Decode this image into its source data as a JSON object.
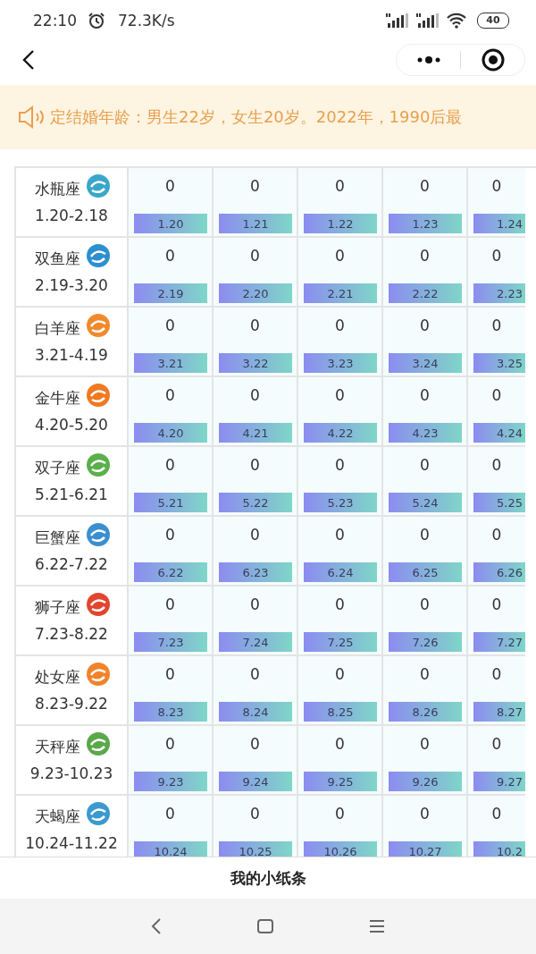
{
  "status_bar": {
    "time": "22:10",
    "speed": "72.3K/s",
    "battery": "40"
  },
  "notice": {
    "text": "定结婚年龄：男生22岁，女生20岁。2022年，1990后最"
  },
  "signs": [
    {
      "name": "水瓶座",
      "range": "1.20-2.18",
      "days": [
        {
          "count": "0",
          "date": "1.20"
        },
        {
          "count": "0",
          "date": "1.21"
        },
        {
          "count": "0",
          "date": "1.22"
        },
        {
          "count": "0",
          "date": "1.23"
        },
        {
          "count": "0",
          "date": "1.24"
        }
      ]
    },
    {
      "name": "双鱼座",
      "range": "2.19-3.20",
      "days": [
        {
          "count": "0",
          "date": "2.19"
        },
        {
          "count": "0",
          "date": "2.20"
        },
        {
          "count": "0",
          "date": "2.21"
        },
        {
          "count": "0",
          "date": "2.22"
        },
        {
          "count": "0",
          "date": "2.23"
        }
      ]
    },
    {
      "name": "白羊座",
      "range": "3.21-4.19",
      "days": [
        {
          "count": "0",
          "date": "3.21"
        },
        {
          "count": "0",
          "date": "3.22"
        },
        {
          "count": "0",
          "date": "3.23"
        },
        {
          "count": "0",
          "date": "3.24"
        },
        {
          "count": "0",
          "date": "3.25"
        }
      ]
    },
    {
      "name": "金牛座",
      "range": "4.20-5.20",
      "days": [
        {
          "count": "0",
          "date": "4.20"
        },
        {
          "count": "0",
          "date": "4.21"
        },
        {
          "count": "0",
          "date": "4.22"
        },
        {
          "count": "0",
          "date": "4.23"
        },
        {
          "count": "0",
          "date": "4.24"
        }
      ]
    },
    {
      "name": "双子座",
      "range": "5.21-6.21",
      "days": [
        {
          "count": "0",
          "date": "5.21"
        },
        {
          "count": "0",
          "date": "5.22"
        },
        {
          "count": "0",
          "date": "5.23"
        },
        {
          "count": "0",
          "date": "5.24"
        },
        {
          "count": "0",
          "date": "5.25"
        }
      ]
    },
    {
      "name": "巨蟹座",
      "range": "6.22-7.22",
      "days": [
        {
          "count": "0",
          "date": "6.22"
        },
        {
          "count": "0",
          "date": "6.23"
        },
        {
          "count": "0",
          "date": "6.24"
        },
        {
          "count": "0",
          "date": "6.25"
        },
        {
          "count": "0",
          "date": "6.26"
        }
      ]
    },
    {
      "name": "狮子座",
      "range": "7.23-8.22",
      "days": [
        {
          "count": "0",
          "date": "7.23"
        },
        {
          "count": "0",
          "date": "7.24"
        },
        {
          "count": "0",
          "date": "7.25"
        },
        {
          "count": "0",
          "date": "7.26"
        },
        {
          "count": "0",
          "date": "7.27"
        }
      ]
    },
    {
      "name": "处女座",
      "range": "8.23-9.22",
      "days": [
        {
          "count": "0",
          "date": "8.23"
        },
        {
          "count": "0",
          "date": "8.24"
        },
        {
          "count": "0",
          "date": "8.25"
        },
        {
          "count": "0",
          "date": "8.26"
        },
        {
          "count": "0",
          "date": "8.27"
        }
      ]
    },
    {
      "name": "天秤座",
      "range": "9.23-10.23",
      "days": [
        {
          "count": "0",
          "date": "9.23"
        },
        {
          "count": "0",
          "date": "9.24"
        },
        {
          "count": "0",
          "date": "9.25"
        },
        {
          "count": "0",
          "date": "9.26"
        },
        {
          "count": "0",
          "date": "9.27"
        }
      ]
    },
    {
      "name": "天蝎座",
      "range": "10.24-11.22",
      "days": [
        {
          "count": "0",
          "date": "10.24"
        },
        {
          "count": "0",
          "date": "10.25"
        },
        {
          "count": "0",
          "date": "10.26"
        },
        {
          "count": "0",
          "date": "10.27"
        },
        {
          "count": "0",
          "date": "10.2"
        }
      ]
    }
  ],
  "bottom_bar": {
    "title": "我的小纸条"
  }
}
